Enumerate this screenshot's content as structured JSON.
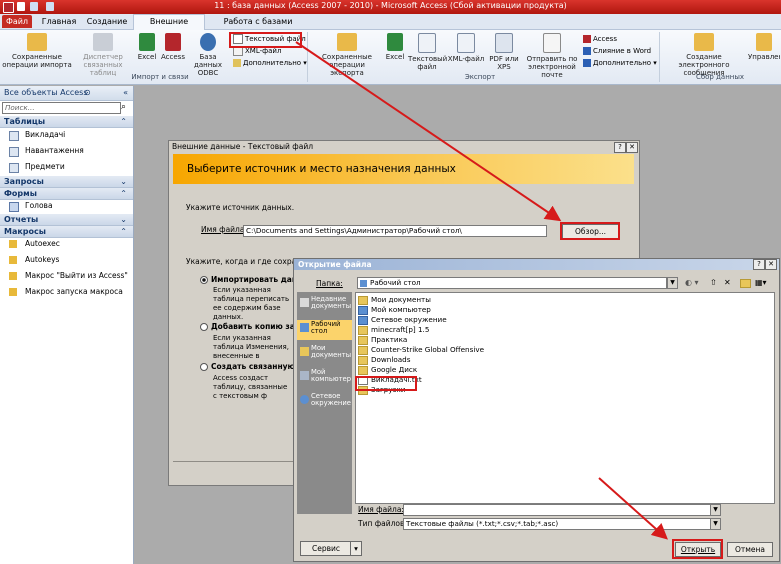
{
  "window": {
    "title": "11 : база данных (Access 2007 - 2010)  -  Microsoft Access (Сбой активации продукта)"
  },
  "tabs": [
    {
      "label": "Файл"
    },
    {
      "label": "Главная"
    },
    {
      "label": "Создание"
    },
    {
      "label": "Внешние данные"
    },
    {
      "label": "Работа с базами данных"
    }
  ],
  "ribbon": {
    "import": {
      "saved_imports": "Сохраненные операции импорта",
      "linked_table_manager": "Диспетчер связанных таблиц",
      "excel": "Excel",
      "access": "Access",
      "odbc": "База данных ODBC",
      "text_file": "Текстовый файл",
      "xml_file": "XML-файл",
      "more": "Дополнительно",
      "group_label": "Импорт и связи"
    },
    "export": {
      "saved_exports": "Сохраненные операции экспорта",
      "excel": "Excel",
      "text_file": "Текстовый файл",
      "xml_file": "XML-файл",
      "pdf_xps": "PDF или XPS",
      "email": "Отправить по электронной почте",
      "access": "Access",
      "word_merge": "Слияние в Word",
      "more": "Дополнительно",
      "group_label": "Экспорт"
    },
    "collect": {
      "create_email": "Создание электронного сообщения",
      "manage_replies": "Управление ответами",
      "group_label": "Сбор данных"
    }
  },
  "nav": {
    "header": "Все объекты Access",
    "search_placeholder": "Поиск...",
    "sections": [
      {
        "label": "Таблицы",
        "items": [
          "Викладачі",
          "Навантаження",
          "Предмети"
        ]
      },
      {
        "label": "Запросы",
        "items": []
      },
      {
        "label": "Формы",
        "items": [
          "Голова"
        ]
      },
      {
        "label": "Отчеты",
        "items": []
      },
      {
        "label": "Макросы",
        "items": [
          "Autoexec",
          "Autokeys",
          "Макрос \"Выйти из Access\"",
          "Макрос запуска макроса"
        ]
      }
    ]
  },
  "import_dialog": {
    "title": "Внешние данные - Текстовый файл",
    "banner": "Выберите источник и место назначения данных",
    "source_prompt": "Укажите источник данных.",
    "file_name_label": "Имя файла:",
    "file_name_value": "C:\\Documents and Settings\\Администратор\\Рабочий стол\\",
    "browse_button": "Обзор...",
    "dest_prompt": "Укажите, когда и где сохранять",
    "opt_import": "Импортировать данн",
    "opt_import_desc": "Если указанная таблица переписать ее содержим базе данных.",
    "opt_append": "Добавить копию запи",
    "opt_append_desc": "Если указанная таблица Изменения, внесенные в",
    "opt_link": "Создать связанную т",
    "opt_link_desc": "Access создаст таблицу, связанные с текстовым ф"
  },
  "open_dialog": {
    "title": "Открытие файла",
    "folder_label": "Папка:",
    "folder_value": "Рабочий стол",
    "places": [
      "Недавние документы",
      "Рабочий стол",
      "Мои документы",
      "Мой компьютер",
      "Сетевое окружение"
    ],
    "files": [
      "Мои документы",
      "Мой компьютер",
      "Сетевое окружение",
      "minecraft[p] 1.5",
      "Практика",
      "Counter-Strike Global Offensive",
      "Downloads",
      "Google Диск",
      "Викладачі.txt",
      "Загрузки"
    ],
    "file_name_label": "Имя файла:",
    "file_name_value": "",
    "file_type_label": "Тип файлов:",
    "file_type_value": "Текстовые файлы (*.txt;*.csv;*.tab;*.asc)",
    "service_button": "Сервис",
    "open_button": "Открыть",
    "cancel_button": "Отмена"
  }
}
